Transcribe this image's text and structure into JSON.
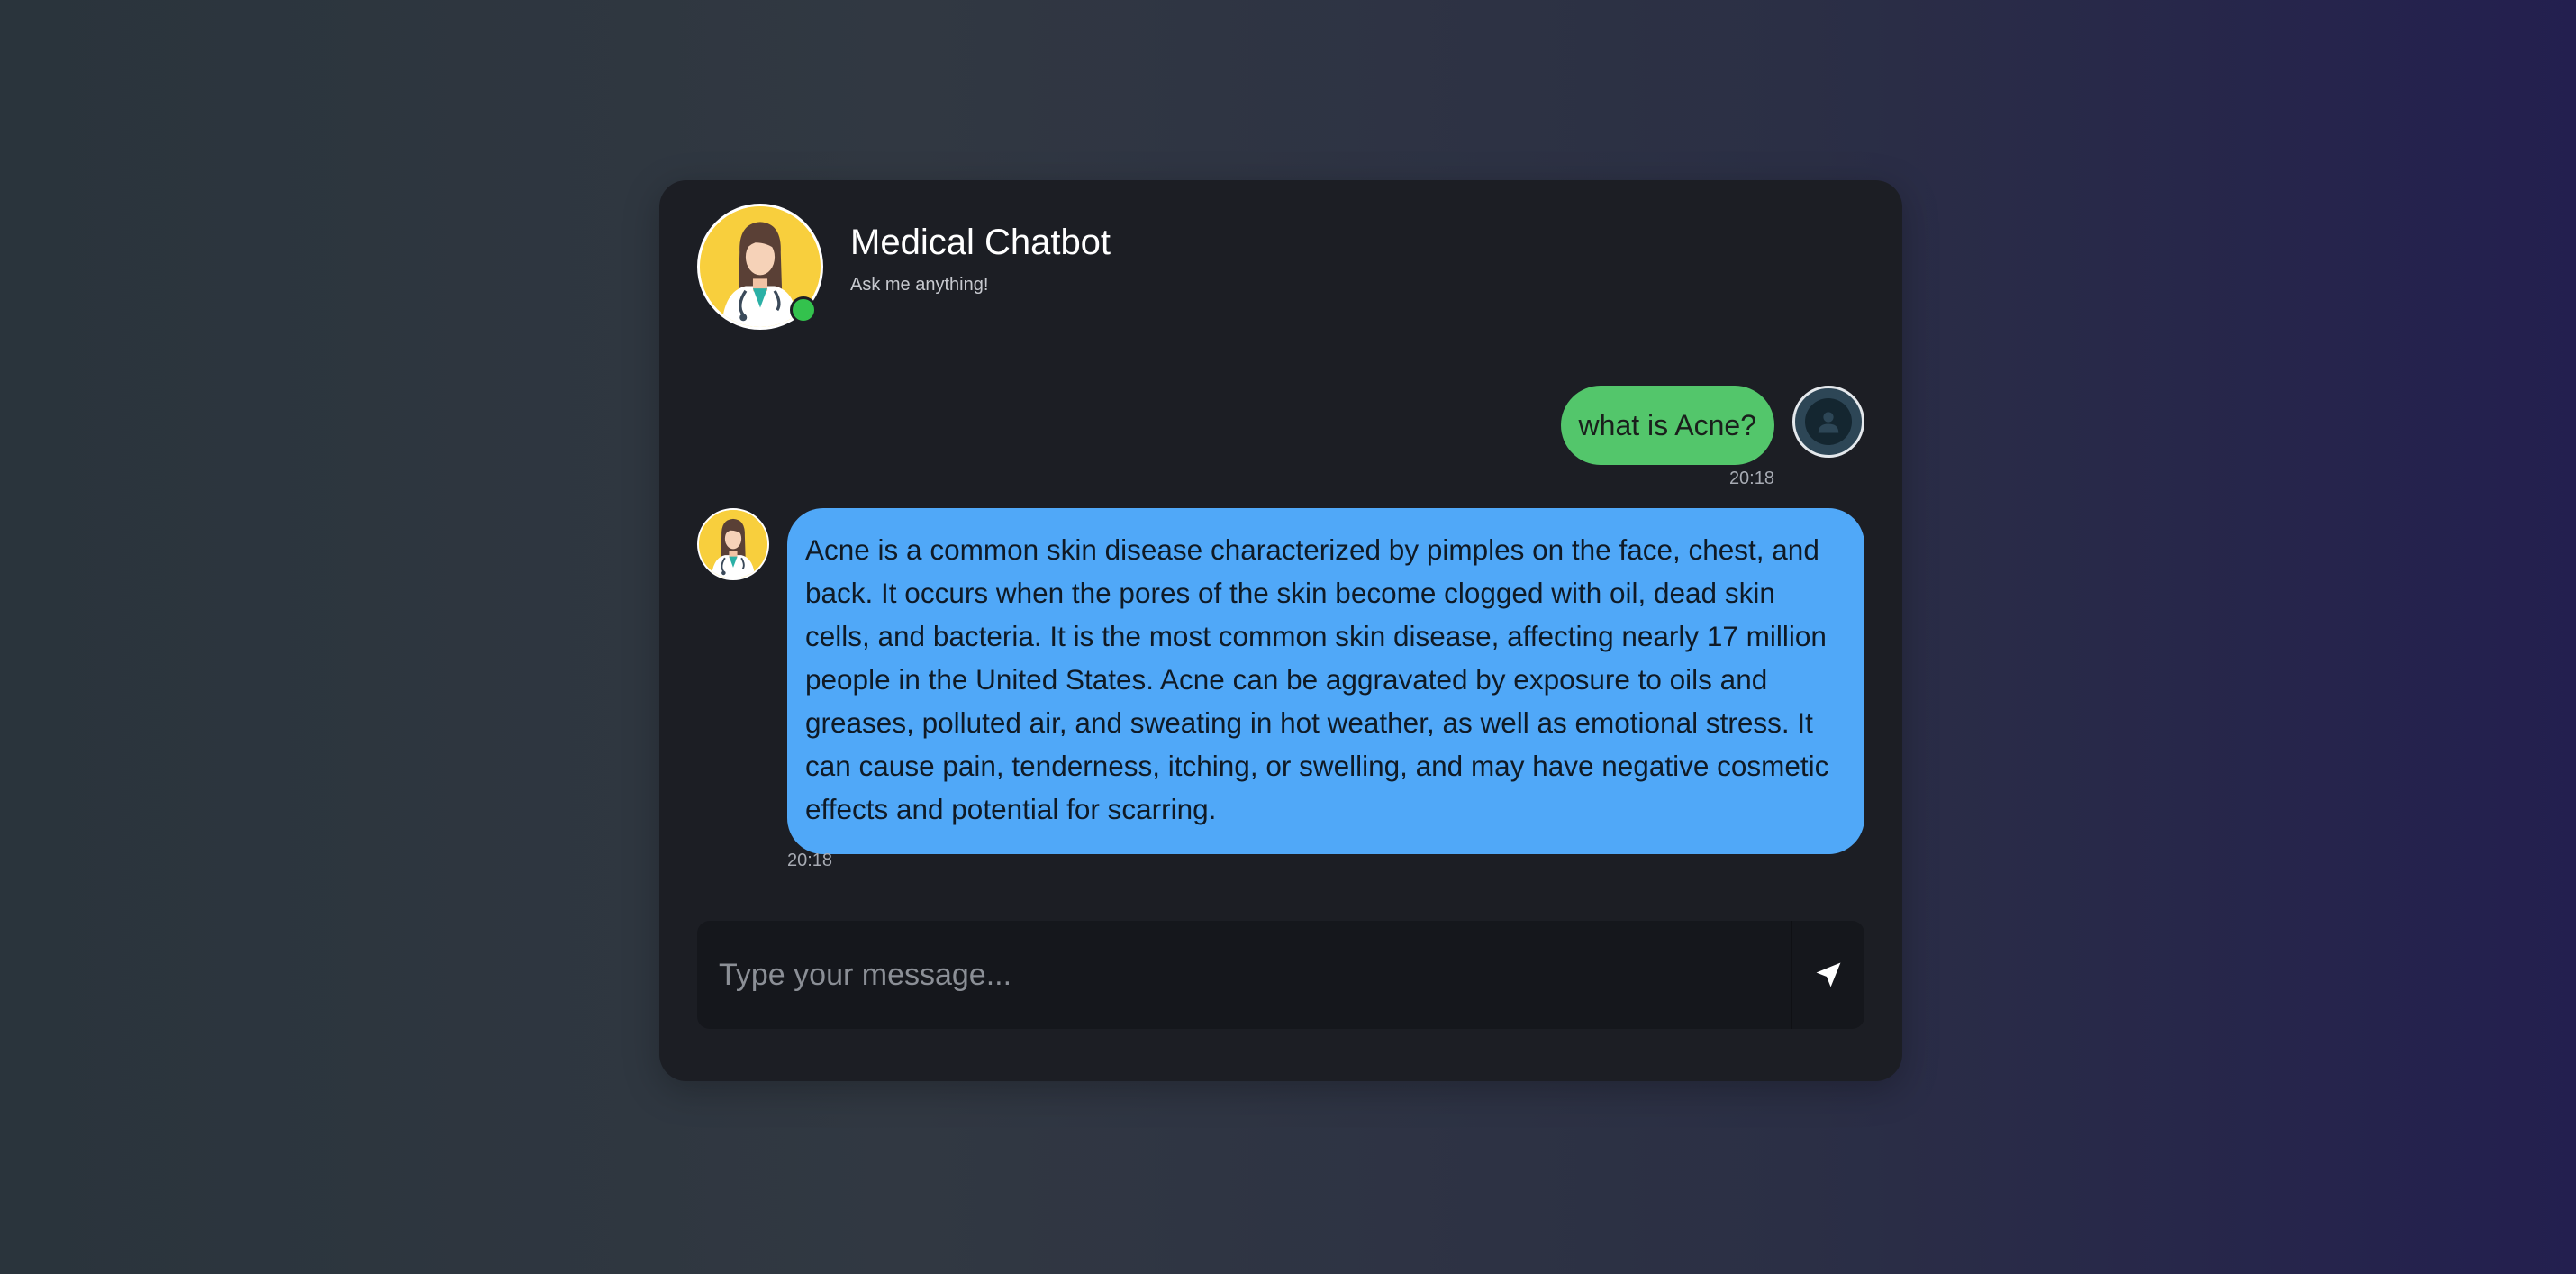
{
  "header": {
    "title": "Medical Chatbot",
    "subtitle": "Ask me anything!",
    "status": "online"
  },
  "messages": [
    {
      "sender": "user",
      "text": "what is Acne?",
      "time": "20:18"
    },
    {
      "sender": "bot",
      "text": "Acne is a common skin disease characterized by pimples on the face, chest, and back. It occurs when the pores of the skin become clogged with oil, dead skin cells, and bacteria. It is the most common skin disease, affecting nearly 17 million people in the United States. Acne can be aggravated by exposure to oils and greases, polluted air, and sweating in hot weather, as well as emotional stress. It can cause pain, tenderness, itching, or swelling, and may have negative cosmetic effects and potential for scarring.",
      "time": "20:18"
    }
  ],
  "composer": {
    "placeholder": "Type your message...",
    "value": "",
    "send_icon": "send-icon"
  },
  "colors": {
    "user_bubble": "#53c66b",
    "bot_bubble": "#50a8f8",
    "online": "#33c24d",
    "card": "#1c1e24"
  }
}
